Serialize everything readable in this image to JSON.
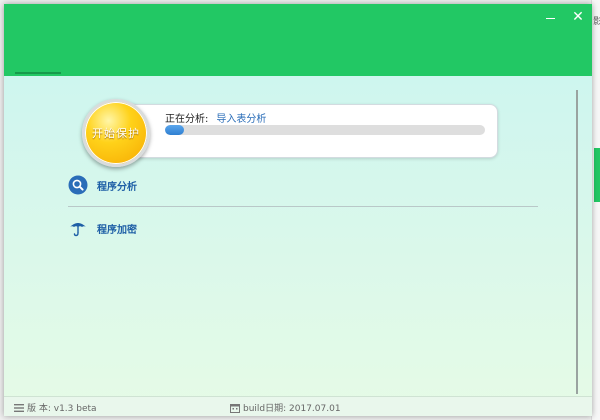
{
  "window": {
    "minimize_label": "—",
    "close_label": "✕"
  },
  "protect": {
    "start_label": "开始保护",
    "status_label": "正在分析:",
    "status_value": "导入表分析",
    "progress_fraction": 0.06
  },
  "menu": {
    "items": [
      {
        "label": "程序分析",
        "icon": "magnifier-icon"
      },
      {
        "label": "程序加密",
        "icon": "umbrella-icon"
      }
    ]
  },
  "statusbar": {
    "version": "版 本: v1.3 beta",
    "build": "build日期: 2017.07.01"
  },
  "colors": {
    "header_green": "#22c864",
    "accent_blue": "#1e5fa6",
    "progress_blue": "#2f7fd1",
    "button_gold": "#ffd21a"
  },
  "background_app": {
    "glyph": "影"
  }
}
